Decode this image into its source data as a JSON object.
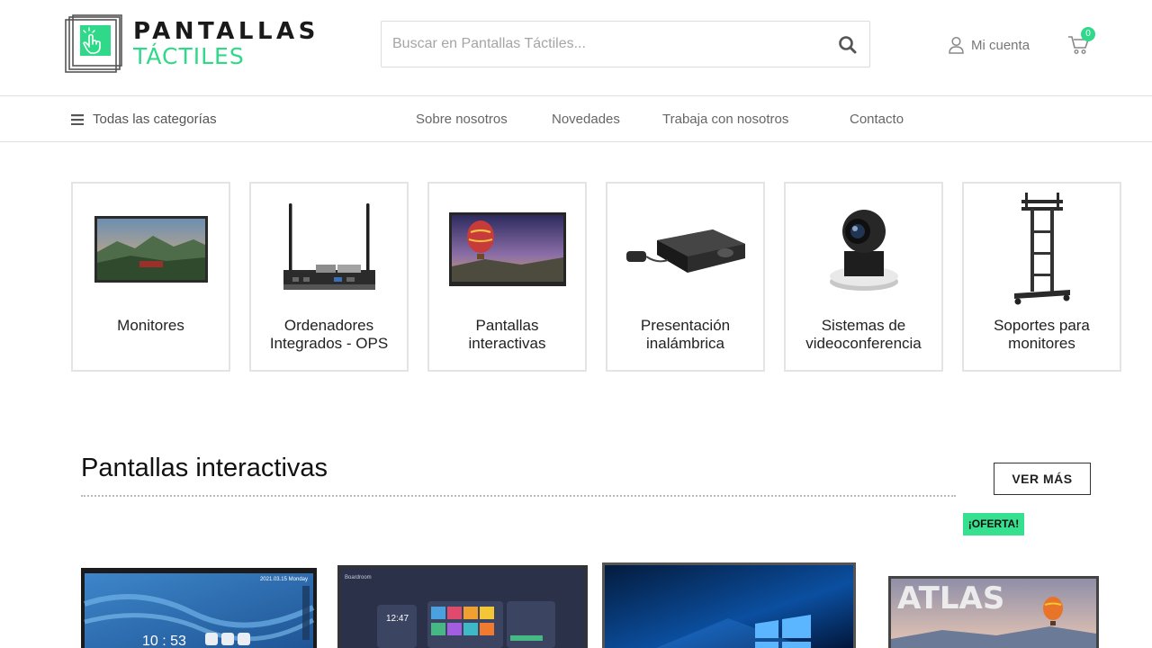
{
  "header": {
    "logo": {
      "line1": "PANTALLAS",
      "line2": "TÁCTILES"
    },
    "search": {
      "placeholder": "Buscar en Pantallas Táctiles..."
    },
    "account_label": "Mi cuenta",
    "cart_count": "0"
  },
  "nav": {
    "all_categories": "Todas las categorías",
    "links": [
      "Sobre nosotros",
      "Novedades",
      "Trabaja con nosotros",
      "Contacto"
    ]
  },
  "categories": [
    {
      "line1": "Monitores",
      "line2": ""
    },
    {
      "line1": "Ordenadores",
      "line2": "Integrados - OPS"
    },
    {
      "line1": "Pantallas",
      "line2": "interactivas"
    },
    {
      "line1": "Presentación",
      "line2": "inalámbrica"
    },
    {
      "line1": "Sistemas de",
      "line2": "videoconferencia"
    },
    {
      "line1": "Soportes para",
      "line2": "monitores"
    }
  ],
  "section": {
    "title": "Pantallas interactivas",
    "more_button": "VER MÁS",
    "offer_badge": "¡OFERTA!"
  },
  "products": [
    {
      "screen_date": "2021.03.15 Monday",
      "screen_time": "10 : 53"
    },
    {
      "screen_header": "Boardroom",
      "screen_time": "12:47"
    },
    {},
    {
      "screen_brand": "ATLAS"
    }
  ],
  "colors": {
    "accent": "#2fd989",
    "offer": "#36e08f"
  }
}
